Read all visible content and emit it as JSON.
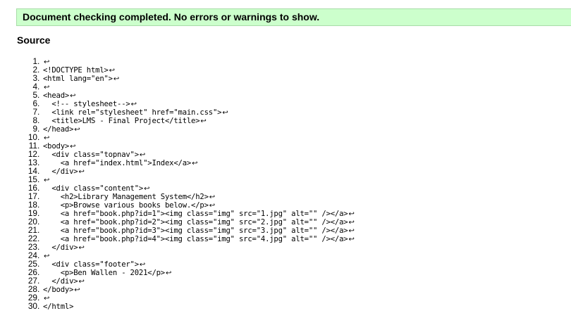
{
  "banner": {
    "message": "Document checking completed. No errors or warnings to show."
  },
  "source": {
    "heading": "Source",
    "return_symbol": "↩",
    "lines": [
      {
        "num": "1",
        "code": "",
        "ret": true
      },
      {
        "num": "2",
        "code": "<!DOCTYPE html>",
        "ret": true
      },
      {
        "num": "3",
        "code": "<html lang=\"en\">",
        "ret": true
      },
      {
        "num": "4",
        "code": "",
        "ret": true
      },
      {
        "num": "5",
        "code": "<head>",
        "ret": true
      },
      {
        "num": "6",
        "code": "  <!-- stylesheet-->",
        "ret": true
      },
      {
        "num": "7",
        "code": "  <link rel=\"stylesheet\" href=\"main.css\">",
        "ret": true
      },
      {
        "num": "8",
        "code": "  <title>LMS - Final Project</title>",
        "ret": true
      },
      {
        "num": "9",
        "code": "</head>",
        "ret": true
      },
      {
        "num": "10",
        "code": "",
        "ret": true
      },
      {
        "num": "11",
        "code": "<body>",
        "ret": true
      },
      {
        "num": "12",
        "code": "  <div class=\"topnav\">",
        "ret": true
      },
      {
        "num": "13",
        "code": "    <a href=\"index.html\">Index</a>",
        "ret": true
      },
      {
        "num": "14",
        "code": "  </div>",
        "ret": true
      },
      {
        "num": "15",
        "code": "",
        "ret": true
      },
      {
        "num": "16",
        "code": "  <div class=\"content\">",
        "ret": true
      },
      {
        "num": "17",
        "code": "    <h2>Library Management System</h2>",
        "ret": true
      },
      {
        "num": "18",
        "code": "    <p>Browse various books below.</p>",
        "ret": true
      },
      {
        "num": "19",
        "code": "    <a href=\"book.php?id=1\"><img class=\"img\" src=\"1.jpg\" alt=\"\" /></a>",
        "ret": true
      },
      {
        "num": "20",
        "code": "    <a href=\"book.php?id=2\"><img class=\"img\" src=\"2.jpg\" alt=\"\" /></a>",
        "ret": true
      },
      {
        "num": "21",
        "code": "    <a href=\"book.php?id=3\"><img class=\"img\" src=\"3.jpg\" alt=\"\" /></a>",
        "ret": true
      },
      {
        "num": "22",
        "code": "    <a href=\"book.php?id=4\"><img class=\"img\" src=\"4.jpg\" alt=\"\" /></a>",
        "ret": true
      },
      {
        "num": "23",
        "code": "  </div>",
        "ret": true
      },
      {
        "num": "24",
        "code": "",
        "ret": true
      },
      {
        "num": "25",
        "code": "  <div class=\"footer\">",
        "ret": true
      },
      {
        "num": "26",
        "code": "    <p>Ben Wallen - 2021</p>",
        "ret": true
      },
      {
        "num": "27",
        "code": "  </div>",
        "ret": true
      },
      {
        "num": "28",
        "code": "</body>",
        "ret": true
      },
      {
        "num": "29",
        "code": "",
        "ret": true
      },
      {
        "num": "30",
        "code": "</html>",
        "ret": false
      }
    ]
  }
}
